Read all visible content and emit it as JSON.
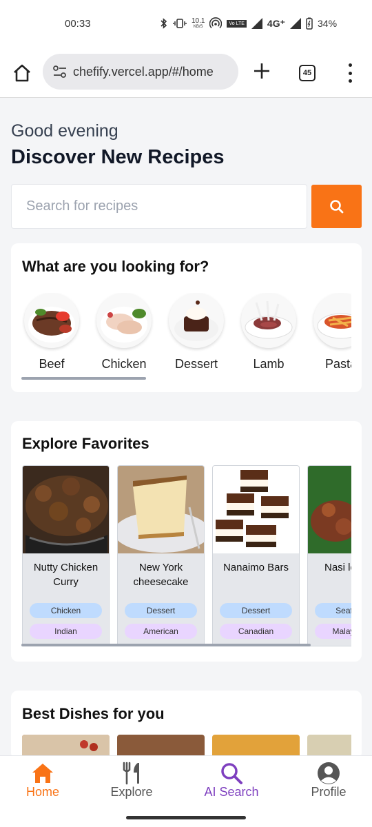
{
  "status_bar": {
    "time": "00:33",
    "net_speed_value": "10.1",
    "net_speed_unit": "KB/S",
    "volte_label": "Vo LTE",
    "network": "4G⁺",
    "battery": "34%"
  },
  "browser": {
    "url": "chefify.vercel.app/#/home",
    "tab_count": "45"
  },
  "header": {
    "greeting": "Good evening",
    "title": "Discover New Recipes"
  },
  "search": {
    "placeholder": "Search for recipes"
  },
  "categories": {
    "title": "What are you looking for?",
    "items": [
      {
        "label": "Beef"
      },
      {
        "label": "Chicken"
      },
      {
        "label": "Dessert"
      },
      {
        "label": "Lamb"
      },
      {
        "label": "Pasta"
      }
    ]
  },
  "favorites": {
    "title": "Explore Favorites",
    "items": [
      {
        "name": "Nutty Chicken Curry",
        "category": "Chicken",
        "area": "Indian"
      },
      {
        "name": "New York cheesecake",
        "category": "Dessert",
        "area": "American"
      },
      {
        "name": "Nanaimo Bars",
        "category": "Dessert",
        "area": "Canadian"
      },
      {
        "name": "Nasi lemak",
        "category": "Seafood",
        "area": "Malaysian"
      }
    ]
  },
  "best_dishes": {
    "title": "Best Dishes for you"
  },
  "bottom_nav": {
    "items": [
      {
        "label": "Home",
        "icon": "home-icon",
        "color": "#f97316"
      },
      {
        "label": "Explore",
        "icon": "utensils-icon",
        "color": "#555555"
      },
      {
        "label": "AI Search",
        "icon": "search-icon",
        "color": "#7e3fbf"
      },
      {
        "label": "Profile",
        "icon": "user-circle-icon",
        "color": "#555555"
      }
    ]
  },
  "colors": {
    "accent": "#f97316",
    "ai_purple": "#7e3fbf",
    "tag_blue": "#bfdbfe",
    "tag_purple": "#e9d5ff"
  }
}
